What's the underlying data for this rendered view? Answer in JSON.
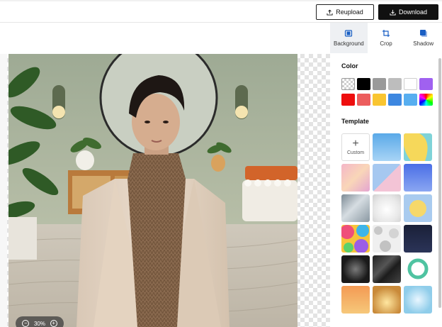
{
  "header": {
    "reupload_label": "Reupload",
    "download_label": "Download"
  },
  "tools": [
    {
      "label": "Background",
      "icon": "background-icon",
      "active": true
    },
    {
      "label": "Crop",
      "icon": "crop-icon",
      "active": false
    },
    {
      "label": "Shadow",
      "icon": "shadow-icon",
      "active": false
    }
  ],
  "canvas": {
    "zoom_label": "30%",
    "zoom_out_icon": "minus-icon",
    "zoom_in_icon": "plus-icon"
  },
  "panel": {
    "color_title": "Color",
    "colors": [
      "transparent",
      "#000000",
      "#9a9a9a",
      "#bdbdbd",
      "#ffffff",
      "#a061f0",
      "#ee0e0e",
      "#ec5d5d",
      "#f9c531",
      "#3d87e0",
      "#57aef0",
      "rainbow"
    ],
    "template_title": "Template",
    "custom_label": "Custom",
    "templates": [
      "custom",
      "sky-blue",
      "yellow-teal",
      "pink-pastel",
      "blue-pink-split",
      "blue-gradient",
      "gray-glass",
      "white-glow",
      "yellow-circle",
      "colorful-blobs",
      "gray-dots",
      "dark-navy",
      "black-spotlight",
      "black-silk",
      "teal-ring",
      "orange-gradient",
      "gold-bokeh",
      "light-blue-bokeh"
    ]
  },
  "accent": {
    "download_bg": "#111111",
    "active_tab_bg": "#eef0f3"
  }
}
